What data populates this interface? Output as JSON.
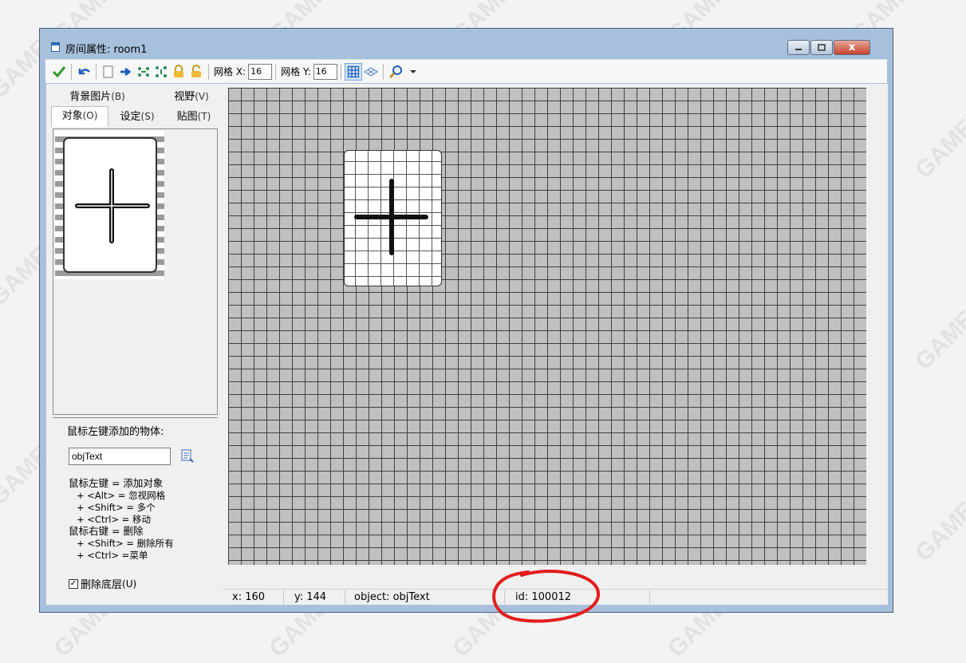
{
  "window": {
    "title": "房间属性: room1",
    "close_glyph": "x"
  },
  "toolbar": {
    "grid_x_label": "网格 X:",
    "grid_x_value": "16",
    "grid_y_label": "网格 Y:",
    "grid_y_value": "16",
    "icons": [
      "check-icon",
      "undo-icon",
      "new-page-icon",
      "arrow-right-icon",
      "shift-horizontal-icon",
      "shift-vertical-icon",
      "lock-icon",
      "unlock-icon",
      "grid-toggle-icon",
      "isometric-icon",
      "zoom-icon",
      "dropdown-icon"
    ]
  },
  "tabs": {
    "background": "背景图片",
    "background_key": "(B)",
    "views": "视野",
    "views_key": "(V)",
    "objects": "对象",
    "objects_key": "(O)",
    "settings": "设定",
    "settings_key": "(S)",
    "tiles": "贴图",
    "tiles_key": "(T)"
  },
  "panel": {
    "add_label": "鼠标左键添加的物体:",
    "object_value": "objText",
    "hints": [
      "鼠标左键 = 添加对象",
      "+ <Alt> = 忽视网格",
      "+ <Shift> = 多个",
      "+ <Ctrl> = 移动",
      "鼠标右键 = 删除",
      "+ <Shift> = 删除所有",
      "+ <Ctrl> =菜单"
    ],
    "delete_underlying_label": "删除底层",
    "delete_underlying_key": "(U)",
    "delete_underlying_checked": true
  },
  "status": {
    "x": "x: 160",
    "y": "y: 144",
    "object": "object: objText",
    "id": "id: 100012"
  },
  "colors": {
    "grid_bg": "#c0c0c0",
    "grid_line": "#404040",
    "annotation": "#e31d1d"
  }
}
